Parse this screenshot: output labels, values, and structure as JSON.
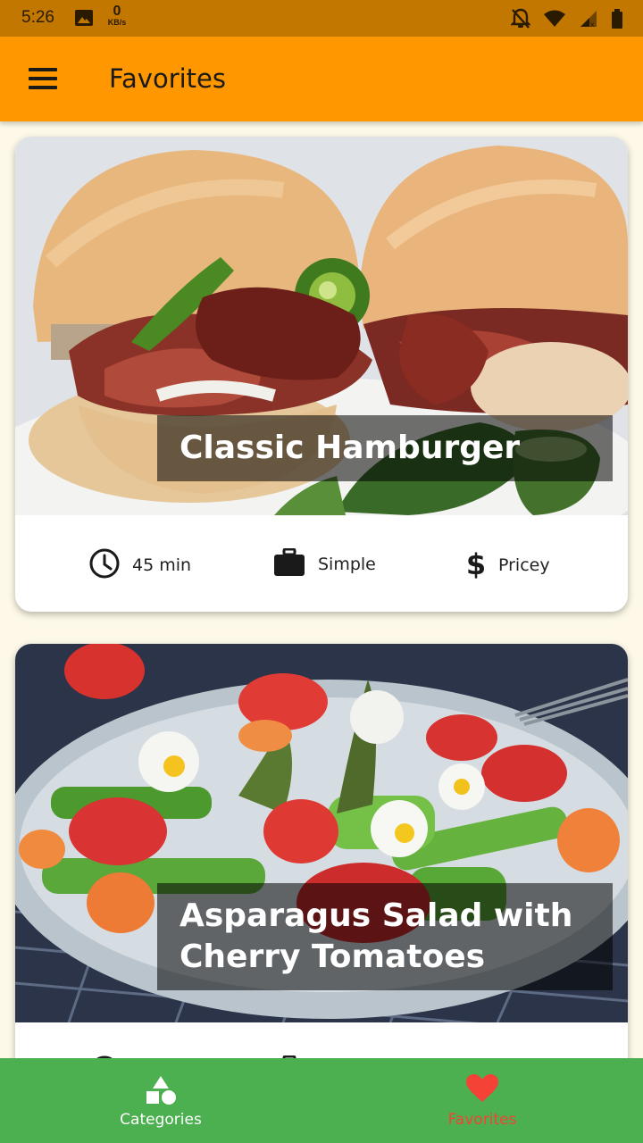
{
  "status_bar": {
    "time": "5:26",
    "net_speed_value": "0",
    "net_speed_unit": "KB/s",
    "icons": [
      "image-icon",
      "notifications-off-icon",
      "wifi-icon",
      "signal-icon",
      "battery-icon"
    ]
  },
  "app_bar": {
    "title": "Favorites",
    "menu_icon": "hamburger-menu-icon",
    "background": "#ff9800"
  },
  "meals": [
    {
      "title": "Classic Hamburger",
      "duration": "45 min",
      "complexity": "Simple",
      "affordability": "Pricey"
    },
    {
      "title": "Asparagus Salad with Cherry Tomatoes",
      "title_line1": "Asparagus Salad with",
      "title_line2": "Cherry Tomatoes",
      "duration": "",
      "complexity": "",
      "affordability": ""
    }
  ],
  "bottom_nav": {
    "background": "#4caf50",
    "tabs": [
      {
        "label": "Categories",
        "icon": "category-icon",
        "selected": false,
        "color": "#ffffff"
      },
      {
        "label": "Favorites",
        "icon": "heart-icon",
        "selected": true,
        "color": "#f44336"
      }
    ]
  }
}
